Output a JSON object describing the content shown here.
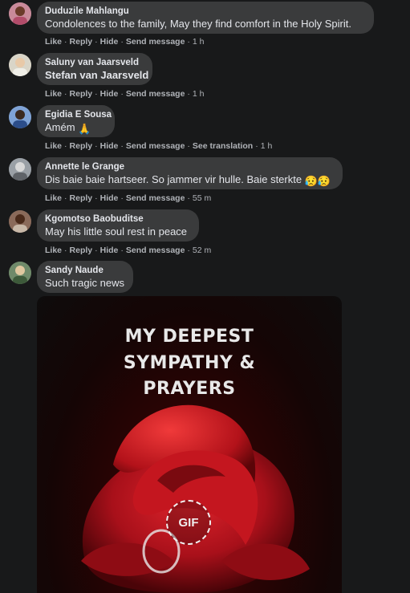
{
  "actions": {
    "like": "Like",
    "reply": "Reply",
    "hide": "Hide",
    "send_message": "Send message",
    "see_translation": "See translation",
    "dot": "·"
  },
  "comments": [
    {
      "author": "Duduzile Mahlangu",
      "text": "Condolences to the family, May they find comfort in the Holy Spirit.",
      "time": "1 h"
    },
    {
      "author": "Saluny van Jaarsveld",
      "text": "Stefan van Jaarsveld",
      "time": "1 h"
    },
    {
      "author": "Egidia E Sousa",
      "text": "Amém",
      "emoji": "🙏",
      "time": "1 h"
    },
    {
      "author": "Annette le Grange",
      "text": "Dis baie baie hartseer. So jammer vir hulle. Baie sterkte",
      "emoji": "😥😥",
      "time": "55 m"
    },
    {
      "author": "Kgomotso Baobuditse",
      "text": "May his little soul rest in peace",
      "time": "52 m"
    },
    {
      "author": "Sandy Naude",
      "text": "Such tragic news"
    }
  ],
  "gif": {
    "line1": "MY DEEPEST",
    "line2": "SYMPATHY &",
    "line3": "PRAYERS",
    "badge": "GIF"
  },
  "colors": {
    "background": "#18191a",
    "bubble": "#3a3b3c",
    "text": "#e4e6eb",
    "secondary": "#b0b3b8",
    "rose": "#b3121a"
  }
}
